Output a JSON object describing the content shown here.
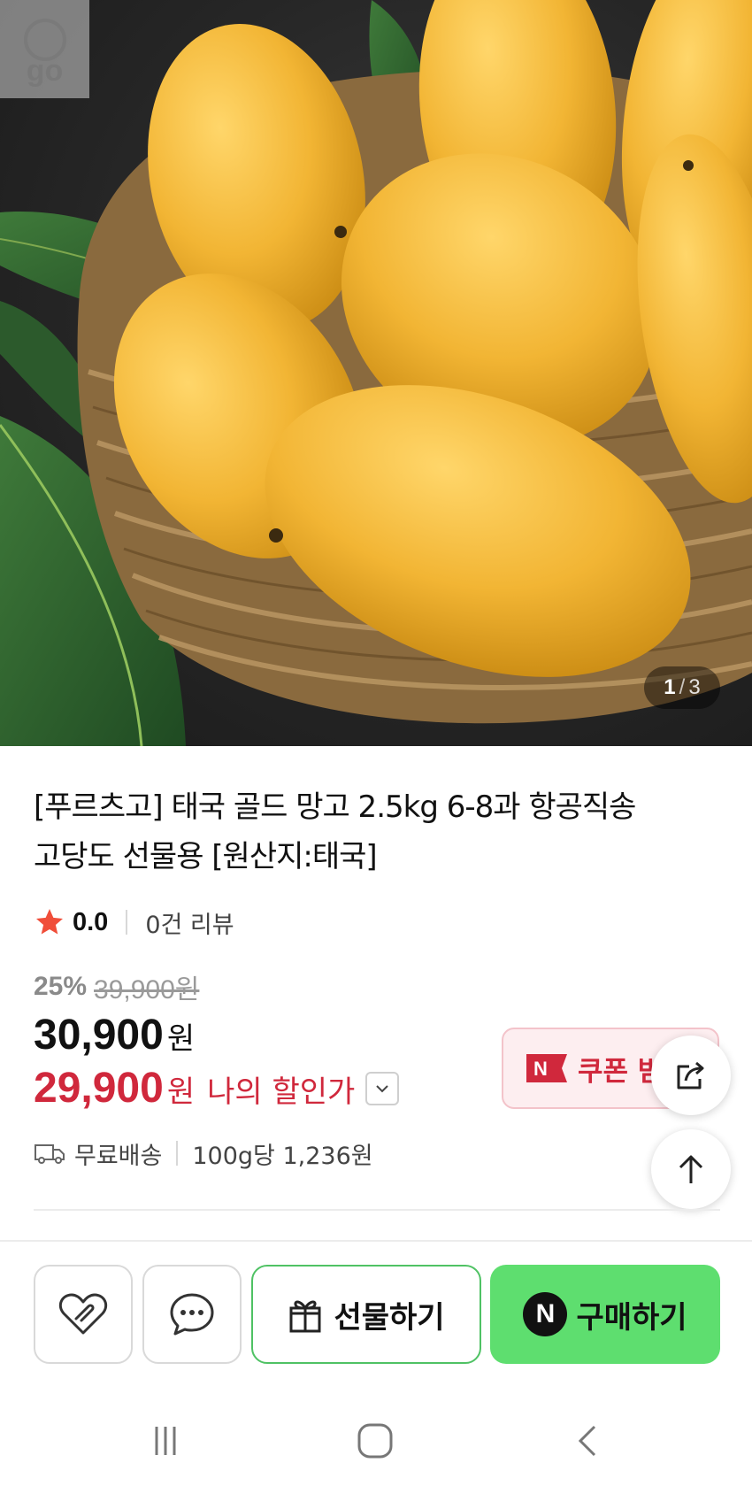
{
  "hero": {
    "logo_text": "go",
    "pager_current": "1",
    "pager_separator": "/",
    "pager_total": "3"
  },
  "product": {
    "title_line1": "[푸르츠고] 태국 골드 망고 2.5kg 6-8과 항공직송",
    "title_line2": "고당도 선물용 [원산지:태국]",
    "rating_score": "0.0",
    "review_count": "0건 리뷰",
    "discount_percent": "25%",
    "original_price": "39,900원",
    "price": "30,900",
    "price_unit": "원",
    "my_price": "29,900",
    "my_price_unit": "원",
    "my_price_label": "나의 할인가",
    "coupon_label": "쿠폰 받기",
    "delivery": "무료배송",
    "unit_price": "100g당 1,236원"
  },
  "actions": {
    "gift_label": "선물하기",
    "buy_label": "구매하기",
    "buy_badge": "N"
  },
  "colors": {
    "accent_red": "#d0283c",
    "buy_green": "#5ede6f",
    "gift_border": "#4fc264",
    "star": "#f04e3a"
  },
  "icons": [
    "heart-icon",
    "chat-bubble-icon",
    "gift-icon",
    "share-icon",
    "arrow-up-icon",
    "truck-icon",
    "chevron-down-icon",
    "star-icon",
    "naver-pay-icon"
  ]
}
